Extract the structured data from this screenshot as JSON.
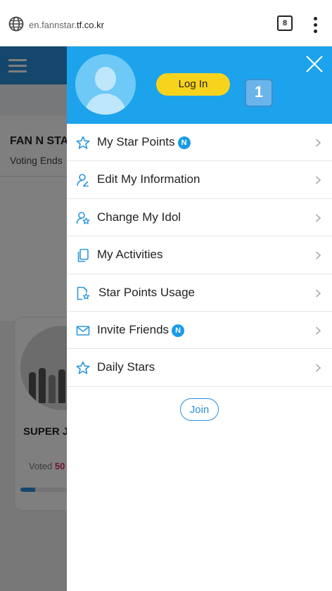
{
  "browser": {
    "url_prefix": "en.fannstar.",
    "url_host": "tf.co.kr",
    "tab_count": "8"
  },
  "page": {
    "title": "FAN N STA",
    "subtitle": "Voting Ends",
    "card_name": "SUPER JU",
    "card_voted_label": "Voted ",
    "card_voted_value": "50",
    "card_progress_fraction": 0.15,
    "brand_color": "#2a8fd8"
  },
  "drawer": {
    "header_color": "#1ca3ec",
    "login_label": "Log In",
    "keycap_label": "1",
    "join_label": "Join",
    "badge_label": "N",
    "items": [
      {
        "label": "My Star Points",
        "icon": "star-icon",
        "badge": true
      },
      {
        "label": "Edit My Information",
        "icon": "user-edit-icon",
        "badge": false
      },
      {
        "label": "Change My Idol",
        "icon": "user-star-icon",
        "badge": false
      },
      {
        "label": "My Activities",
        "icon": "documents-icon",
        "badge": false
      },
      {
        "label": "Star Points Usage",
        "icon": "document-star-icon",
        "badge": false
      },
      {
        "label": "Invite Friends",
        "icon": "mail-icon",
        "badge": true
      },
      {
        "label": "Daily Stars",
        "icon": "star-icon",
        "badge": false
      }
    ]
  }
}
